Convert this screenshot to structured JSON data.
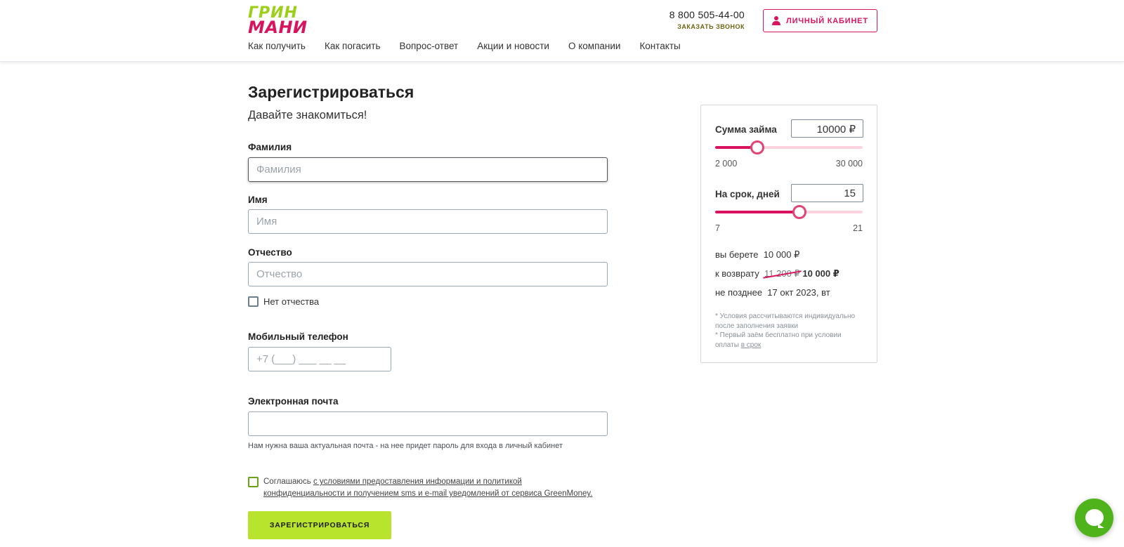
{
  "header": {
    "logo_line1": "ГРИН",
    "logo_line2": "МАНИ",
    "phone": "8 800 505-44-00",
    "callback_label": "ЗАКАЗАТЬ ЗВОНОК",
    "cabinet_label": "ЛИЧНЫЙ КАБИНЕТ",
    "nav": [
      "Как получить",
      "Как погасить",
      "Вопрос-ответ",
      "Акции и новости",
      "О компании",
      "Контакты"
    ]
  },
  "form": {
    "title": "Зарегистрироваться",
    "subtitle": "Давайте знакомиться!",
    "last_name": {
      "label": "Фамилия",
      "placeholder": "Фамилия",
      "value": ""
    },
    "first_name": {
      "label": "Имя",
      "placeholder": "Имя",
      "value": ""
    },
    "middle_name": {
      "label": "Отчество",
      "placeholder": "Отчество",
      "value": ""
    },
    "no_middle_name_label": "Нет отчества",
    "phone": {
      "label": "Мобильный телефон",
      "placeholder": "+7 (___) ___ __ __",
      "value": ""
    },
    "email": {
      "label": "Электронная почта",
      "placeholder": "",
      "value": ""
    },
    "email_hint": "Нам нужна ваша актуальная почта - на нее придет пароль для входа в личный кабинет",
    "consent_prefix": "Соглашаюсь ",
    "consent_link": "с условиями предоставления информации и политикой конфиденциальности и получением sms и e-mail уведомлений от сервиса GreenMoney.",
    "submit_label": "ЗАРЕГИСТРИРОВАТЬСЯ"
  },
  "calculator": {
    "amount_label": "Сумма займа",
    "amount_value": "10000 ₽",
    "amount_min": "2 000",
    "amount_max": "30 000",
    "amount_fraction": 0.2857,
    "term_label": "На срок, дней",
    "term_value": "15",
    "term_min": "7",
    "term_max": "21",
    "term_fraction": 0.5714,
    "take_label": "вы берете",
    "take_value": "10 000 ₽",
    "return_label": "к возврату",
    "return_old": "11 200 ₽",
    "return_new": "10 000 ₽",
    "deadline_label": "не позднее",
    "deadline_value": "17 окт 2023, вт",
    "note1": "* Условия рассчитываются индивидуально после заполнения заявки",
    "note2_prefix": "* Первый заём бесплатно при условии оплаты ",
    "note2_link": "в срок"
  },
  "colors": {
    "brand_pink": "#d8145f",
    "brand_green": "#9ccf17",
    "submit_green": "#b9e42e",
    "chat_green": "#4fb31b"
  },
  "icons": {
    "cabinet": "user-icon",
    "chat": "chat-icon"
  }
}
